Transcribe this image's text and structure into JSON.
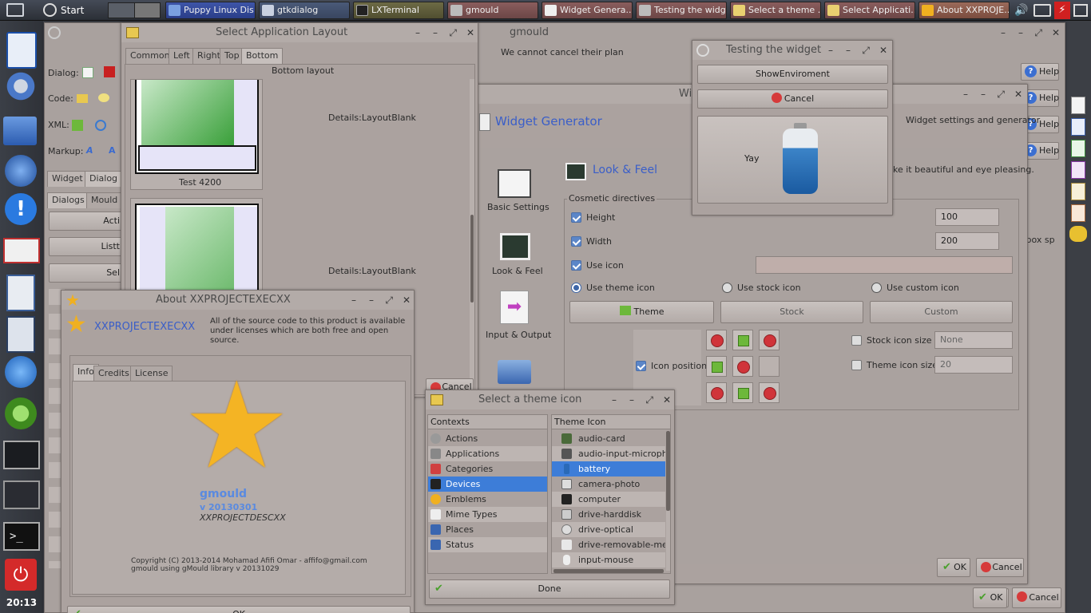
{
  "taskbar": {
    "start_label": "Start Here",
    "tasks": [
      {
        "label": "Puppy Linux Dis",
        "style": "blue"
      },
      {
        "label": "gtkdialog",
        "style": "gray"
      },
      {
        "label": "LXTerminal",
        "style": "olive"
      },
      {
        "label": "gmould",
        "style": "red"
      },
      {
        "label": "Widget Genera...",
        "style": "red"
      },
      {
        "label": "Testing the widget",
        "style": "red"
      },
      {
        "label": "Select a theme ...",
        "style": "red"
      },
      {
        "label": "Select Applicati...",
        "style": "red"
      },
      {
        "label": "About XXPROJE...",
        "style": "red"
      }
    ]
  },
  "clock": "20:13",
  "gmould": {
    "title": "gmould",
    "notice": "We cannot cancel their plan",
    "dialog_label": "Dialog:",
    "code_label": "Code:",
    "xml_label": "XML:",
    "markup_label": "Markup:",
    "tabs1": [
      "Widget",
      "Dialog"
    ],
    "tabs2": [
      "Dialogs",
      "Mould"
    ],
    "side_buttons": [
      "Acti",
      "Listt",
      "Sel"
    ],
    "help": "Help",
    "ok": "OK",
    "cancel": "Cancel",
    "right_text": "vbox sp"
  },
  "layout_win": {
    "title": "Select Application Layout",
    "tabs": [
      "Common",
      "Left",
      "Right",
      "Top",
      "Bottom"
    ],
    "heading": "Bottom layout",
    "item1_caption": "Test 4200",
    "details1": "Details:LayoutBlank",
    "details2": "Details:LayoutBlank",
    "cancel": "Cancel"
  },
  "widget_gen": {
    "title": "Wid",
    "header": "Widget Generator",
    "subtitle": "Widget settings and generator",
    "nav": [
      "Basic Settings",
      "Look & Feel",
      "Input & Output"
    ],
    "section_title": "Look & Feel",
    "section_desc": "ke it beautiful and eye pleasing.",
    "group": "Cosmetic directives",
    "height_label": "Height",
    "height_val": "100",
    "width_label": "Width",
    "width_val": "200",
    "use_icon": "Use icon",
    "use_theme_icon": "Use theme icon",
    "use_stock_icon": "Use stock icon",
    "use_custom_icon": "Use custom icon",
    "theme_btn": "Theme",
    "stock_btn": "Stock",
    "custom_btn": "Custom",
    "icon_position": "Icon position",
    "stock_icon_size": "Stock icon size",
    "stock_size_val": "None",
    "theme_icon_size": "Theme icon size",
    "theme_size_val": "20",
    "ok": "OK",
    "cancel": "Cancel"
  },
  "testing": {
    "title": "Testing the widget",
    "show_env": "ShowEnviroment",
    "cancel": "Cancel",
    "yay": "Yay"
  },
  "about": {
    "title": "About XXPROJECTEXECXX",
    "app_title": "XXPROJECTEXECXX",
    "desc": "All of the source code to this product is available under licenses which are both free and open source.",
    "tabs": [
      "Info",
      "Credits",
      "License"
    ],
    "app_name": "gmould",
    "version": "v 20130301",
    "project_desc": "XXPROJECTDESCXX",
    "copyright": "Copyright (C) 2013-2014 Mohamad Afifi Omar - affifo@gmail.com",
    "library": "gmould using gMould library v 20131029",
    "ok": "OK"
  },
  "theme_win": {
    "title": "Select a theme icon",
    "col1": "Contexts",
    "col2": "Theme Icon",
    "contexts": [
      "Actions",
      "Applications",
      "Categories",
      "Devices",
      "Emblems",
      "Mime Types",
      "Places",
      "Status"
    ],
    "icons": [
      "audio-card",
      "audio-input-microphone",
      "battery",
      "camera-photo",
      "computer",
      "drive-harddisk",
      "drive-optical",
      "drive-removable-media",
      "input-mouse"
    ],
    "done": "Done"
  }
}
